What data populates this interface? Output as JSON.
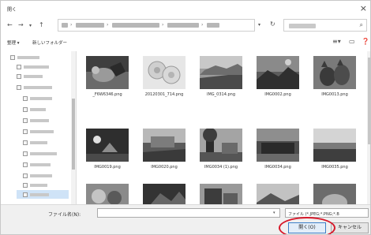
{
  "window": {
    "title": "開く"
  },
  "toolbar": {
    "organize": "整理 ▾",
    "new_folder": "新しいフォルダー"
  },
  "files": [
    {
      "name": "_F6W6346.png"
    },
    {
      "name": "20120301_714.png"
    },
    {
      "name": "IMG_0314.png"
    },
    {
      "name": "IMG0002.png"
    },
    {
      "name": "IMG0013.png"
    },
    {
      "name": "IMG0019.png"
    },
    {
      "name": "IMG0020.png"
    },
    {
      "name": "IMG0034 (1).png"
    },
    {
      "name": "IMG0034.png"
    },
    {
      "name": "IMG0035.png"
    },
    {
      "name": ""
    },
    {
      "name": ""
    },
    {
      "name": ""
    },
    {
      "name": ""
    },
    {
      "name": ""
    }
  ],
  "footer": {
    "filename_label": "ファイル名(N):",
    "filename_value": "",
    "filetype": "ファイル (*.JPEG;*.PNG;*.B",
    "open_label": "開く(O)",
    "cancel_label": "キャンセル"
  }
}
